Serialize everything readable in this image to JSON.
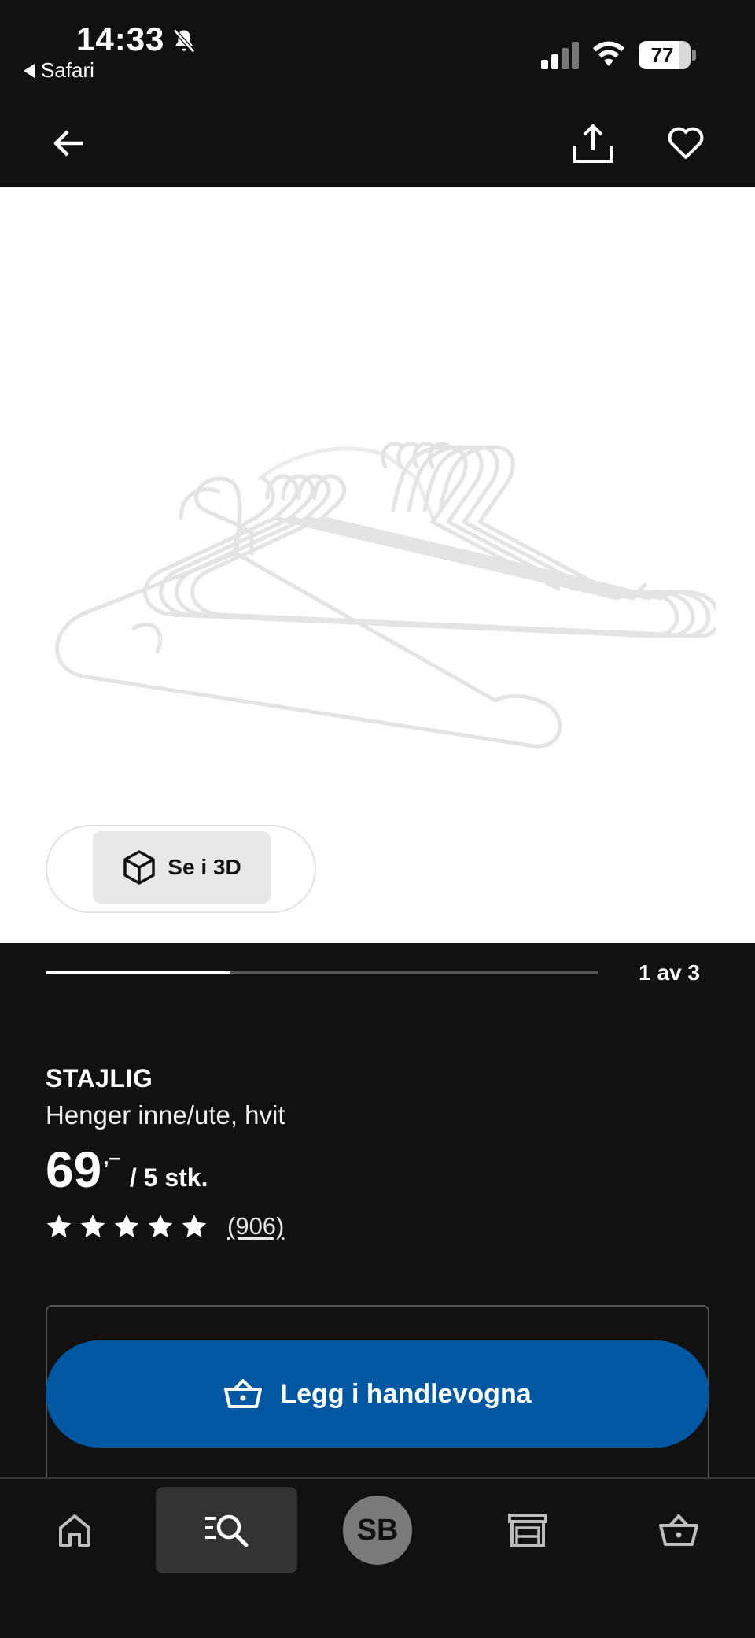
{
  "status_bar": {
    "time": "14:33",
    "back_app": "Safari",
    "battery_percent": "77",
    "battery_level": 0.77
  },
  "header": {
    "back_icon": "arrow-left-icon",
    "share_icon": "share-icon",
    "favorite_icon": "heart-icon"
  },
  "gallery": {
    "view_3d_label": "Se i 3D",
    "pager_text": "1 av 3",
    "pager_progress": 0.333
  },
  "product": {
    "name": "STAJLIG",
    "description": "Henger inne/ute, hvit",
    "price_integer": "69",
    "price_decimal": ",–",
    "price_unit": "/ 5 stk.",
    "rating_stars": 5,
    "review_count": "(906)"
  },
  "cart": {
    "add_button_label": "Legg i handlevogna"
  },
  "bottom_nav": {
    "avatar_initials": "SB",
    "items": [
      "home-icon",
      "search-icon",
      "profile-avatar",
      "store-icon",
      "basket-icon"
    ]
  },
  "colors": {
    "background": "#111111",
    "primary_button": "#0058a3",
    "image_background": "#ffffff"
  }
}
